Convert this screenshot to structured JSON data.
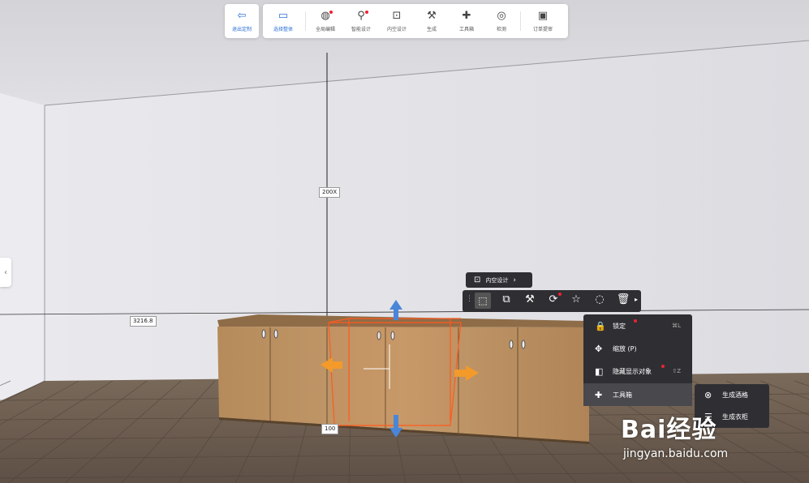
{
  "toolbar": {
    "exit_label": "退出定制",
    "select_label": "选择整体",
    "tools": [
      {
        "icon": "globe-edit-icon",
        "label": "全局编辑"
      },
      {
        "icon": "smart-design-icon",
        "label": "智能设计"
      },
      {
        "icon": "inner-space-icon",
        "label": "内空设计"
      },
      {
        "icon": "generate-icon",
        "label": "生成"
      },
      {
        "icon": "puzzle-icon",
        "label": "工具箱"
      },
      {
        "icon": "check-icon",
        "label": "检测"
      }
    ],
    "order_label": "订单提审"
  },
  "dimensions": {
    "height": "200X",
    "left_distance": "3216.8",
    "bottom": "100"
  },
  "context": {
    "inner_design_label": "内空设计"
  },
  "menu": {
    "items": [
      {
        "label": "锁定",
        "shortcut": "⌘L",
        "icon": "lock-icon"
      },
      {
        "label": "缩放 (P)",
        "shortcut": "",
        "icon": "move-icon"
      },
      {
        "label": "隐藏显示对象",
        "shortcut": "⇧Z",
        "icon": "visibility-icon"
      },
      {
        "label": "工具箱",
        "shortcut": "",
        "icon": "puzzle-icon"
      }
    ],
    "submenu": [
      {
        "label": "生成酒格",
        "icon": "wine-rack-icon"
      },
      {
        "label": "生成衣柜",
        "icon": "wardrobe-icon"
      }
    ]
  },
  "watermark": {
    "brand": "Bai经验",
    "url": "jingyan.baidu.com"
  },
  "colors": {
    "accent": "#2b6fd6",
    "selection": "#ff5a1f",
    "wood": "#b88d5d"
  }
}
